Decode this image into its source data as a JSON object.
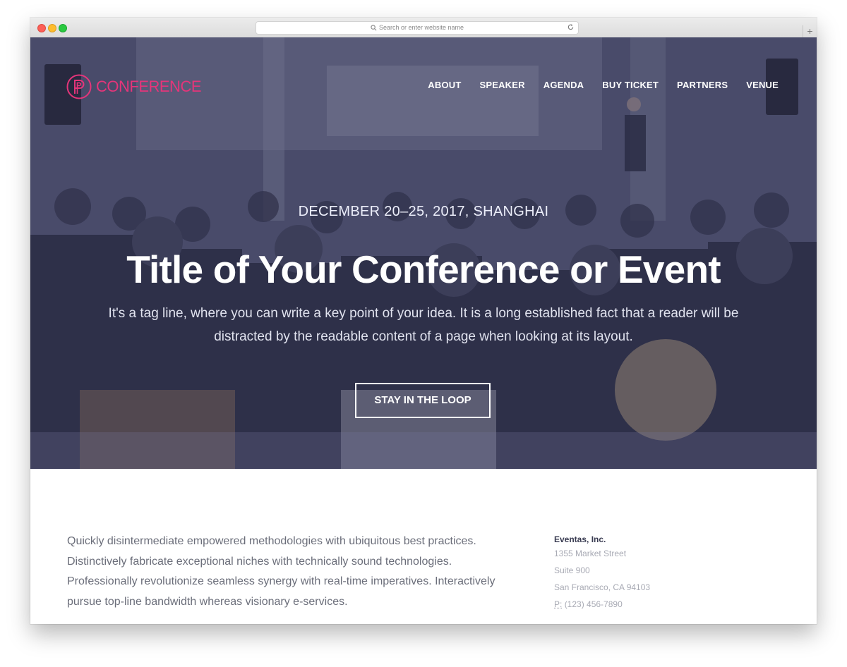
{
  "browser": {
    "url_placeholder": "Search or enter website name",
    "new_tab": "+"
  },
  "brand": {
    "name": "CONFERENCE",
    "accent": "#e5357a"
  },
  "nav": {
    "items": [
      "ABOUT",
      "SPEAKER",
      "AGENDA",
      "BUY TICKET",
      "PARTNERS",
      "VENUE"
    ]
  },
  "hero": {
    "date": "DECEMBER 20–25, 2017, SHANGHAI",
    "title": "Title of Your Conference or Event",
    "tagline": "It's a tag line, where you can write a key point of your idea. It is a long established fact that a reader will be distracted by the readable content of a page when looking at its layout.",
    "cta": "STAY IN THE LOOP"
  },
  "content": {
    "intro": "Quickly disintermediate empowered methodologies with ubiquitous best practices. Distinctively fabricate exceptional niches with technically sound technologies. Professionally revolutionize seamless synergy with real-time imperatives. Interactively pursue top-line bandwidth whereas visionary e-services.",
    "contact": {
      "company": "Eventas, Inc.",
      "street": "1355 Market Street",
      "suite": "Suite 900",
      "city": "San Francisco, CA 94103",
      "phone_label": "P:",
      "phone": "(123) 456-7890"
    }
  }
}
